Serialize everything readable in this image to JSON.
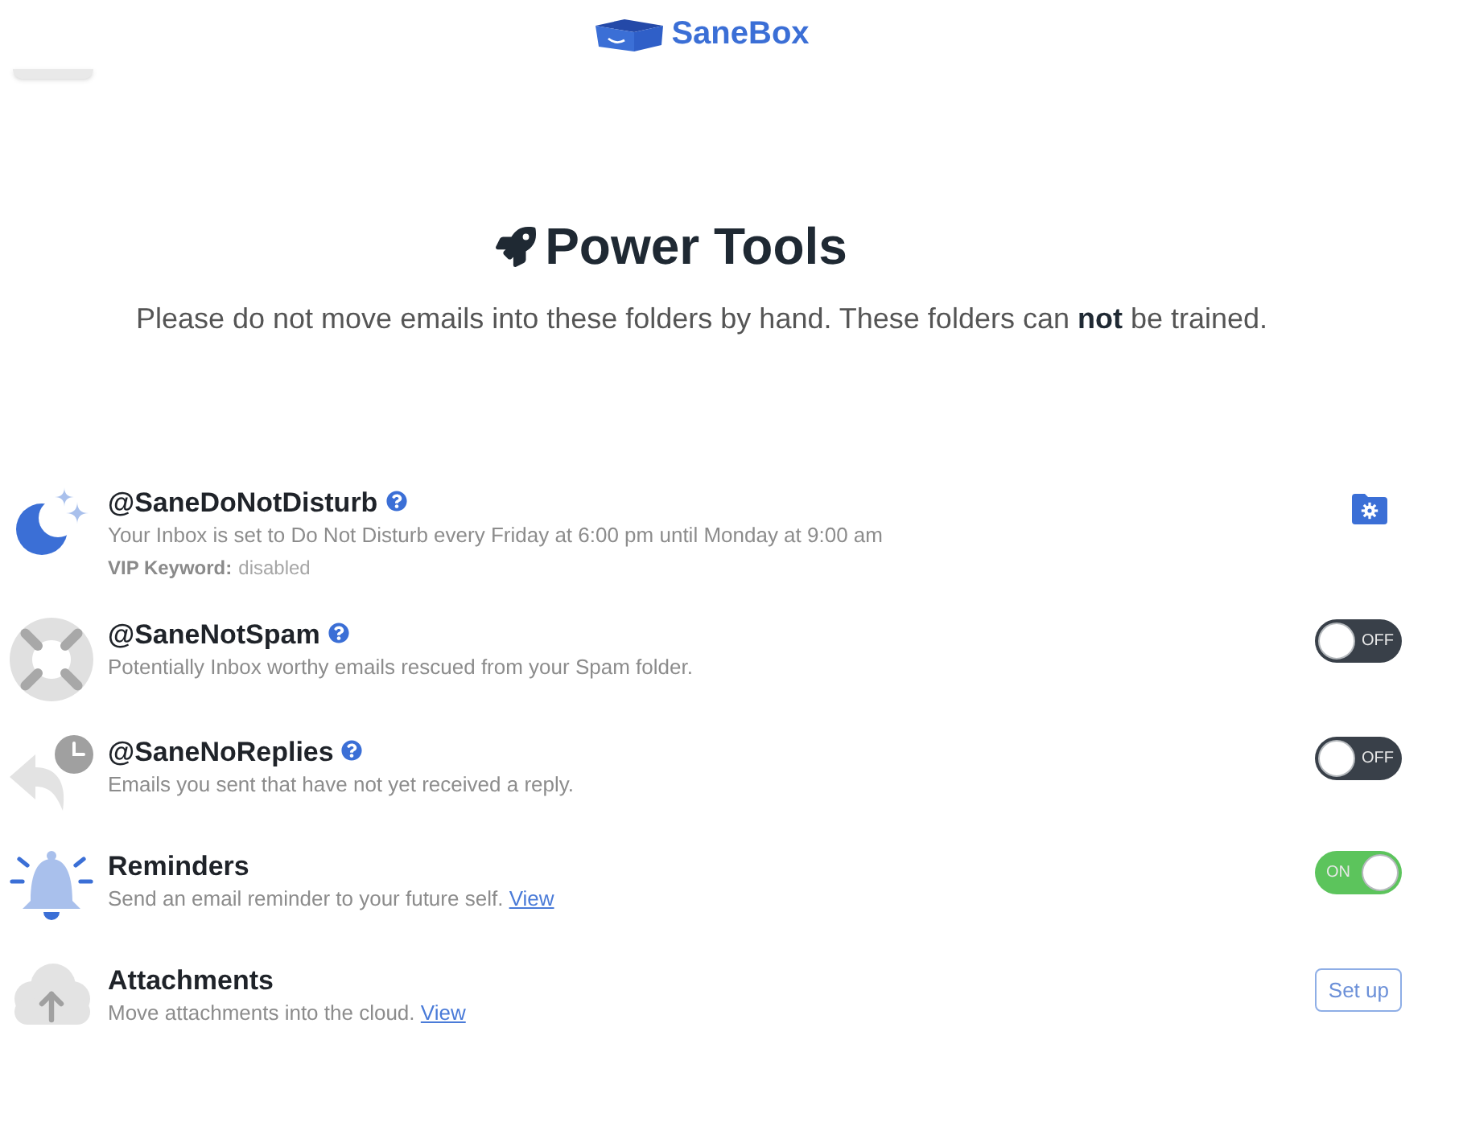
{
  "header": {
    "logo_text": "SaneBox"
  },
  "page": {
    "title": "Power Tools",
    "subtitle": "Please do not move emails into these folders by hand. These folders can **not** be trained."
  },
  "tools": [
    {
      "kind": "settings",
      "name": "@SaneDoNotDisturb",
      "help": true,
      "description": "Your Inbox is set to Do Not Disturb every Friday at 6:00 pm until Monday at 9:00 am",
      "vip_label": "VIP Keyword:",
      "vip_value": "disabled"
    },
    {
      "kind": "toggle",
      "name": "@SaneNotSpam",
      "help": true,
      "description": "Potentially Inbox worthy emails rescued from your Spam folder.",
      "on": false,
      "switch_label": "OFF"
    },
    {
      "kind": "toggle",
      "name": "@SaneNoReplies",
      "help": true,
      "description": "Emails you sent that have not yet received a reply.",
      "on": false,
      "switch_label": "OFF"
    },
    {
      "kind": "toggle",
      "name": "Reminders",
      "help": false,
      "description": "Send an email reminder to your future self.",
      "link": "View",
      "on": true,
      "switch_label": "ON"
    },
    {
      "kind": "button",
      "name": "Attachments",
      "help": false,
      "description": "Move attachments into the cloud.",
      "link": "View",
      "button": "Set up"
    }
  ]
}
